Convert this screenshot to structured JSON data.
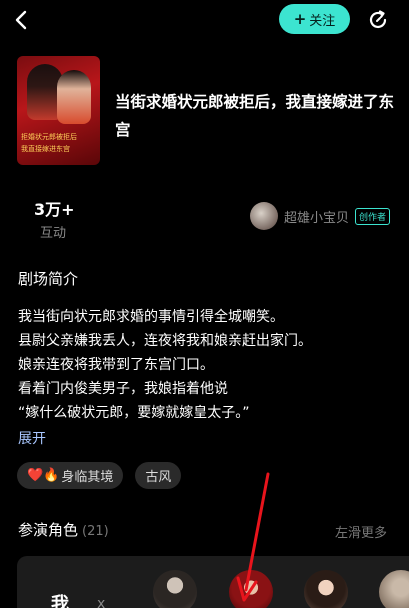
{
  "header": {
    "back_icon": "chevron-left-icon",
    "follow_label": "关注",
    "follow_plus": "+",
    "refresh_icon": "refresh-icon",
    "accent_color": "#3ce4d0"
  },
  "drama": {
    "cover_text_line1": "拒婚状元郎被拒后",
    "cover_text_line2": "我直接嫁进东宫",
    "title": "当街求婚状元郎被拒后，我直接嫁进了东宫"
  },
  "stats": {
    "value": "3万+",
    "label": "互动"
  },
  "creator": {
    "name": "超雄小宝贝",
    "badge": "创作者"
  },
  "intro": {
    "heading": "剧场简介",
    "lines": [
      "我当街向状元郎求婚的事情引得全城嘲笑。",
      "县尉父亲嫌我丢人，连夜将我和娘亲赶出家门。",
      "娘亲连夜将我带到了东宫门口。",
      "看着门内俊美男子，我娘指着他说",
      "“嫁什么破状元郎，要嫁就嫁皇太子。”"
    ],
    "expand": "展开"
  },
  "tags": [
    {
      "icons": "❤️🔥",
      "label": "身临其境"
    },
    {
      "icons": "",
      "label": "古风"
    }
  ],
  "cast": {
    "heading": "参演角色",
    "count": "(21)",
    "more": "左滑更多",
    "me_label": "我",
    "separator": "x"
  }
}
